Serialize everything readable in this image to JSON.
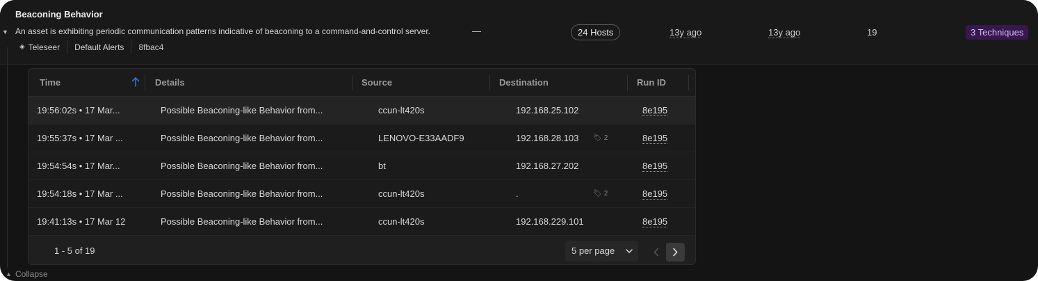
{
  "alert": {
    "title": "Beaconing Behavior",
    "description": "An asset is exhibiting periodic communication patterns indicative of beaconing to a command-and-control server.",
    "dash": "—",
    "hosts": "24 Hosts",
    "first_seen": "13y ago",
    "last_seen": "13y ago",
    "count": "19",
    "techniques": "3 Techniques",
    "tags": [
      "Teleseer",
      "Default Alerts",
      "8fbac4"
    ]
  },
  "table": {
    "columns": [
      "Time",
      "Details",
      "Source",
      "Destination",
      "Run ID"
    ],
    "rows": [
      {
        "time": "19:56:02s • 17 Mar...",
        "details": "Possible Beaconing-like Behavior from...",
        "source": "ccun-lt420s",
        "destination": "192.168.25.102",
        "tags": "",
        "run_id": "8e195"
      },
      {
        "time": "19:55:37s • 17 Mar ...",
        "details": "Possible Beaconing-like Behavior from...",
        "source": "LENOVO-E33AADF9",
        "destination": "192.168.28.103",
        "tags": "2",
        "run_id": "8e195"
      },
      {
        "time": "19:54:54s • 17 Mar...",
        "details": "Possible Beaconing-like Behavior from...",
        "source": "bt",
        "destination": "192.168.27.202",
        "tags": "",
        "run_id": "8e195"
      },
      {
        "time": "19:54:18s • 17 Mar ...",
        "details": "Possible Beaconing-like Behavior from...",
        "source": "ccun-lt420s",
        "destination": ".",
        "tags": "2",
        "run_id": "8e195"
      },
      {
        "time": "19:41:13s • 17 Mar 12",
        "details": "Possible Beaconing-like Behavior from...",
        "source": "ccun-lt420s",
        "destination": "192.168.229.101",
        "tags": "",
        "run_id": "8e195"
      }
    ]
  },
  "pagination": {
    "range": "1 - 5 of 19",
    "per_page": "5 per page"
  },
  "footer": {
    "collapse": "Collapse"
  },
  "colors": {
    "background": "#141414",
    "technique_badge_bg": "#36184d",
    "technique_badge_fg": "#d5b3ff",
    "sort_arrow": "#3b6fd8"
  }
}
